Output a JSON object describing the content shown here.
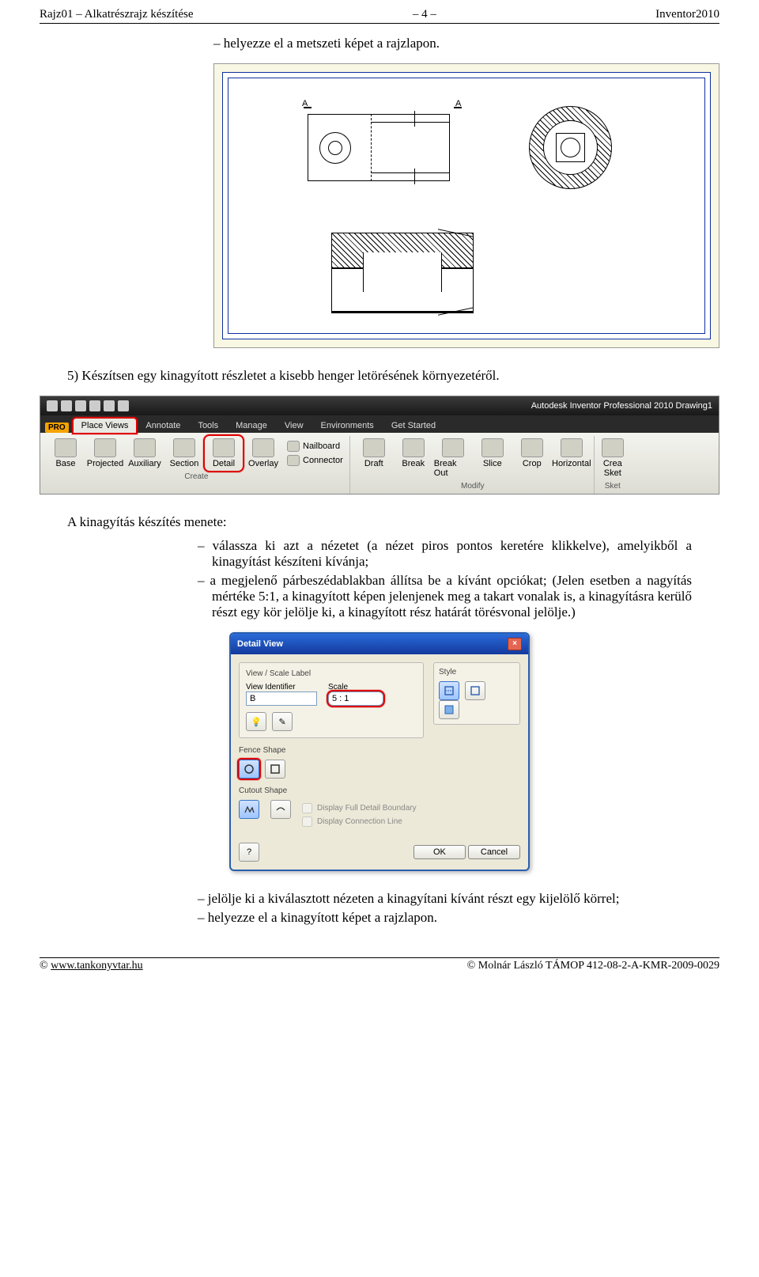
{
  "header": {
    "left": "Rajz01 – Alkatrészrajz készítése",
    "center": "– 4 –",
    "right": "Inventor2010"
  },
  "bullet_top": "helyezze el a metszeti képet a rajzlapon.",
  "step5": "5)  Készítsen egy kinagyított részletet a kisebb henger letörésének környezetéről.",
  "ribbon": {
    "app_title": "Autodesk Inventor Professional 2010    Drawing1",
    "pro": "PRO",
    "tabs": [
      "Place Views",
      "Annotate",
      "Tools",
      "Manage",
      "View",
      "Environments",
      "Get Started"
    ],
    "panel_create": "Create",
    "panel_modify": "Modify",
    "panel_sketch": "Sket",
    "buttons_create": [
      "Base",
      "Projected",
      "Auxiliary",
      "Section",
      "Detail",
      "Overlay"
    ],
    "small_create": [
      "Nailboard",
      "Connector"
    ],
    "buttons_modify": [
      "Draft",
      "Break",
      "Break Out",
      "Slice",
      "Crop",
      "Horizontal"
    ],
    "buttons_sketch": [
      "Crea",
      "Sket"
    ]
  },
  "para_intro": "A kinagyítás készítés menete:",
  "para_items": [
    "válassza ki azt a nézetet (a nézet piros pontos keretére klikkelve), amelyikből a kinagyítást készíteni kívánja;",
    "a megjelenő párbeszédablakban állítsa be a kívánt opciókat; (Jelen esetben a nagyítás mértéke 5:1, a kinagyított képen jelenjenek meg a takart vonalak is, a kinagyításra kerülő részt egy kör jelölje ki, a kinagyított rész határát törésvonal jelölje.)"
  ],
  "dialog": {
    "title": "Detail View",
    "group_viewscale": "View / Scale Label",
    "label_viewid": "View Identifier",
    "label_scale": "Scale",
    "value_viewid": "B",
    "value_scale": "5 : 1",
    "group_style": "Style",
    "group_fence": "Fence Shape",
    "group_cutout": "Cutout Shape",
    "chk_full": "Display Full Detail Boundary",
    "chk_conn": "Display Connection Line",
    "btn_ok": "OK",
    "btn_cancel": "Cancel"
  },
  "foot_items": [
    "jelölje ki a kiválasztott nézeten a kinagyítani kívánt részt egy kijelölő körrel;",
    "helyezze el a kinagyított képet a rajzlapon."
  ],
  "footer": {
    "left_prefix": "© ",
    "left_link": "www.tankonyvtar.hu",
    "right": "© Molnár László TÁMOP 412-08-2-A-KMR-2009-0029"
  }
}
